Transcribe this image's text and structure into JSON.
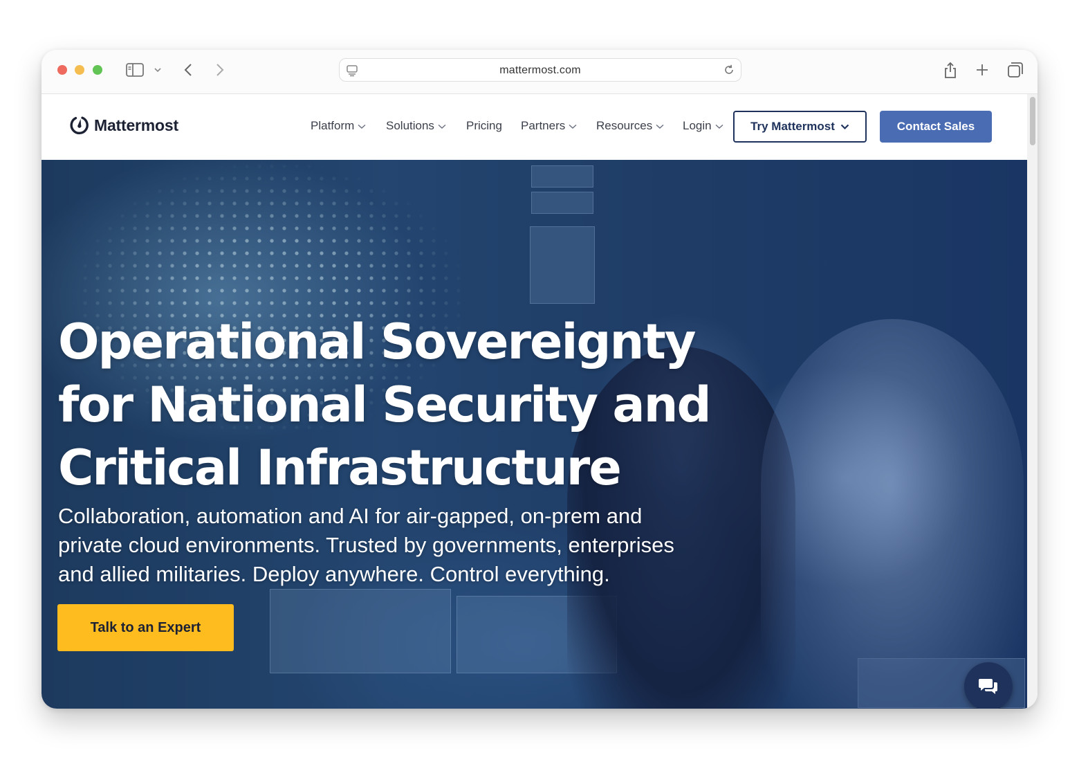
{
  "browser": {
    "url": "mattermost.com"
  },
  "nav": {
    "logo": "Mattermost",
    "items": [
      {
        "label": "Platform"
      },
      {
        "label": "Solutions"
      },
      {
        "label": "Pricing"
      },
      {
        "label": "Partners"
      },
      {
        "label": "Resources"
      },
      {
        "label": "Login"
      }
    ],
    "try_button": "Try Mattermost",
    "contact_button": "Contact Sales"
  },
  "hero": {
    "title_line1": "Operational Sovereignty",
    "title_line2": "for National Security and",
    "title_line3": "Critical Infrastructure",
    "subtitle_line1": "Collaboration, automation and AI for air-gapped, on-prem and",
    "subtitle_line2": "private cloud environments. Trusted by governments, enterprises",
    "subtitle_line3": "and allied militaries. Deploy anywhere. Control everything.",
    "cta": "Talk to an Expert"
  },
  "icons": {
    "sidebar": "sidebar-toggle-icon",
    "back": "chevron-left-icon",
    "forward": "chevron-right-icon",
    "share": "share-icon",
    "new_tab": "plus-icon",
    "tabs": "tab-overview-icon",
    "chat": "chat-bubbles-icon"
  },
  "colors": {
    "brand_navy": "#1e325c",
    "contact_blue": "#4a6cb3",
    "cta_yellow": "#ffbc1f"
  }
}
